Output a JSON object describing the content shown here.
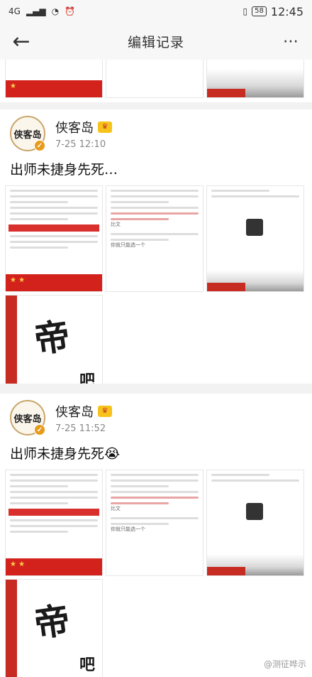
{
  "status": {
    "network": "4G",
    "battery": "58",
    "time": "12:45"
  },
  "nav": {
    "back_glyph": "←",
    "title": "编辑记录",
    "more_glyph": "⋯"
  },
  "posts": [
    {
      "author": "侠客岛",
      "avatar_text": "侠客岛",
      "timestamp": "7-25 12:10",
      "text": "出师未捷身先死…"
    },
    {
      "author": "侠客岛",
      "avatar_text": "侠客岛",
      "timestamp": "7-25 11:52",
      "text": "出师未捷身先死😭"
    }
  ],
  "images": {
    "wall_char_big": "帝",
    "wall_char_small": "吧",
    "caption_a": "比文",
    "caption_b": "你就只能选一个"
  },
  "watermark": "@测征哗示",
  "colors": {
    "flag_red": "#d3221c",
    "accent_orange": "#e89a1a",
    "vip_gold": "#f7c21b"
  }
}
